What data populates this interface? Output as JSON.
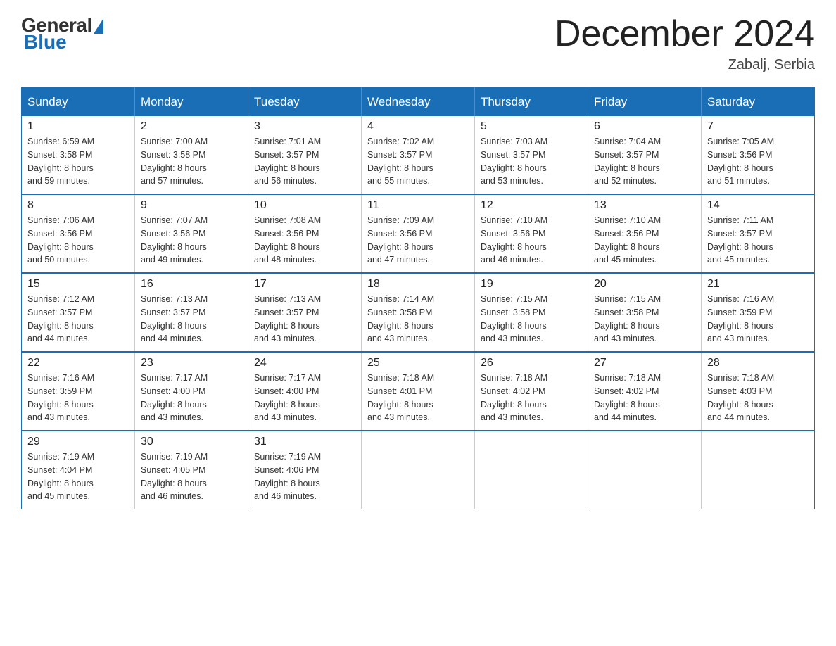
{
  "header": {
    "logo": {
      "general": "General",
      "blue": "Blue"
    },
    "title": "December 2024",
    "location": "Zabalj, Serbia"
  },
  "weekdays": [
    "Sunday",
    "Monday",
    "Tuesday",
    "Wednesday",
    "Thursday",
    "Friday",
    "Saturday"
  ],
  "weeks": [
    [
      {
        "day": "1",
        "sunrise": "6:59 AM",
        "sunset": "3:58 PM",
        "daylight": "8 hours and 59 minutes."
      },
      {
        "day": "2",
        "sunrise": "7:00 AM",
        "sunset": "3:58 PM",
        "daylight": "8 hours and 57 minutes."
      },
      {
        "day": "3",
        "sunrise": "7:01 AM",
        "sunset": "3:57 PM",
        "daylight": "8 hours and 56 minutes."
      },
      {
        "day": "4",
        "sunrise": "7:02 AM",
        "sunset": "3:57 PM",
        "daylight": "8 hours and 55 minutes."
      },
      {
        "day": "5",
        "sunrise": "7:03 AM",
        "sunset": "3:57 PM",
        "daylight": "8 hours and 53 minutes."
      },
      {
        "day": "6",
        "sunrise": "7:04 AM",
        "sunset": "3:57 PM",
        "daylight": "8 hours and 52 minutes."
      },
      {
        "day": "7",
        "sunrise": "7:05 AM",
        "sunset": "3:56 PM",
        "daylight": "8 hours and 51 minutes."
      }
    ],
    [
      {
        "day": "8",
        "sunrise": "7:06 AM",
        "sunset": "3:56 PM",
        "daylight": "8 hours and 50 minutes."
      },
      {
        "day": "9",
        "sunrise": "7:07 AM",
        "sunset": "3:56 PM",
        "daylight": "8 hours and 49 minutes."
      },
      {
        "day": "10",
        "sunrise": "7:08 AM",
        "sunset": "3:56 PM",
        "daylight": "8 hours and 48 minutes."
      },
      {
        "day": "11",
        "sunrise": "7:09 AM",
        "sunset": "3:56 PM",
        "daylight": "8 hours and 47 minutes."
      },
      {
        "day": "12",
        "sunrise": "7:10 AM",
        "sunset": "3:56 PM",
        "daylight": "8 hours and 46 minutes."
      },
      {
        "day": "13",
        "sunrise": "7:10 AM",
        "sunset": "3:56 PM",
        "daylight": "8 hours and 45 minutes."
      },
      {
        "day": "14",
        "sunrise": "7:11 AM",
        "sunset": "3:57 PM",
        "daylight": "8 hours and 45 minutes."
      }
    ],
    [
      {
        "day": "15",
        "sunrise": "7:12 AM",
        "sunset": "3:57 PM",
        "daylight": "8 hours and 44 minutes."
      },
      {
        "day": "16",
        "sunrise": "7:13 AM",
        "sunset": "3:57 PM",
        "daylight": "8 hours and 44 minutes."
      },
      {
        "day": "17",
        "sunrise": "7:13 AM",
        "sunset": "3:57 PM",
        "daylight": "8 hours and 43 minutes."
      },
      {
        "day": "18",
        "sunrise": "7:14 AM",
        "sunset": "3:58 PM",
        "daylight": "8 hours and 43 minutes."
      },
      {
        "day": "19",
        "sunrise": "7:15 AM",
        "sunset": "3:58 PM",
        "daylight": "8 hours and 43 minutes."
      },
      {
        "day": "20",
        "sunrise": "7:15 AM",
        "sunset": "3:58 PM",
        "daylight": "8 hours and 43 minutes."
      },
      {
        "day": "21",
        "sunrise": "7:16 AM",
        "sunset": "3:59 PM",
        "daylight": "8 hours and 43 minutes."
      }
    ],
    [
      {
        "day": "22",
        "sunrise": "7:16 AM",
        "sunset": "3:59 PM",
        "daylight": "8 hours and 43 minutes."
      },
      {
        "day": "23",
        "sunrise": "7:17 AM",
        "sunset": "4:00 PM",
        "daylight": "8 hours and 43 minutes."
      },
      {
        "day": "24",
        "sunrise": "7:17 AM",
        "sunset": "4:00 PM",
        "daylight": "8 hours and 43 minutes."
      },
      {
        "day": "25",
        "sunrise": "7:18 AM",
        "sunset": "4:01 PM",
        "daylight": "8 hours and 43 minutes."
      },
      {
        "day": "26",
        "sunrise": "7:18 AM",
        "sunset": "4:02 PM",
        "daylight": "8 hours and 43 minutes."
      },
      {
        "day": "27",
        "sunrise": "7:18 AM",
        "sunset": "4:02 PM",
        "daylight": "8 hours and 44 minutes."
      },
      {
        "day": "28",
        "sunrise": "7:18 AM",
        "sunset": "4:03 PM",
        "daylight": "8 hours and 44 minutes."
      }
    ],
    [
      {
        "day": "29",
        "sunrise": "7:19 AM",
        "sunset": "4:04 PM",
        "daylight": "8 hours and 45 minutes."
      },
      {
        "day": "30",
        "sunrise": "7:19 AM",
        "sunset": "4:05 PM",
        "daylight": "8 hours and 46 minutes."
      },
      {
        "day": "31",
        "sunrise": "7:19 AM",
        "sunset": "4:06 PM",
        "daylight": "8 hours and 46 minutes."
      },
      null,
      null,
      null,
      null
    ]
  ],
  "labels": {
    "sunrise": "Sunrise:",
    "sunset": "Sunset:",
    "daylight": "Daylight:"
  }
}
